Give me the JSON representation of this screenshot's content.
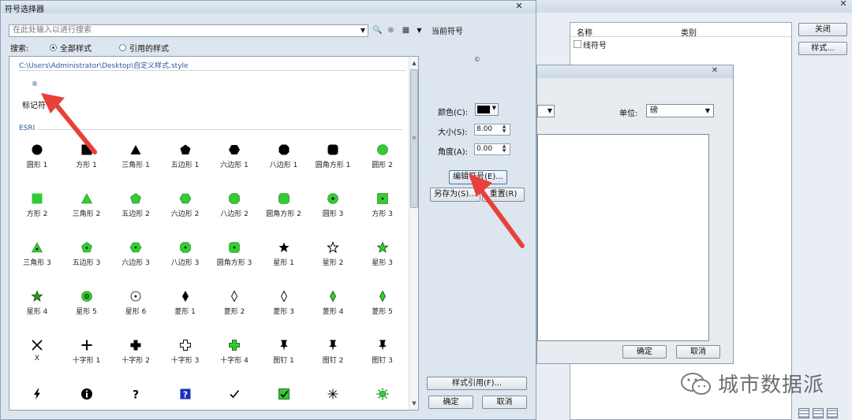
{
  "background_window": {
    "list_headers": [
      "名称",
      "类别"
    ],
    "list_items": [
      "线符号"
    ],
    "close_label": "关闭",
    "styles_label": "样式..."
  },
  "middle_dialog": {
    "unit_label": "单位:",
    "unit_value": "磅",
    "ok_label": "确定",
    "cancel_label": "取消"
  },
  "main_dialog": {
    "title": "符号选择器",
    "search_placeholder": "在此处输入以进行搜索",
    "scope_label": "搜索:",
    "radio_all": "全部样式",
    "radio_referenced": "引用的样式",
    "style_path": "C:\\Users\\Administrator\\Desktop\\自定义样式.style",
    "custom_symbol_label": "标记符",
    "custom_symbol_glyph": "®",
    "esri_group_label": "ESRI",
    "symbols": [
      {
        "label": "圆形 1",
        "icon": "circle-black"
      },
      {
        "label": "方形 1",
        "icon": "square-black"
      },
      {
        "label": "三角形 1",
        "icon": "triangle-black"
      },
      {
        "label": "五边形 1",
        "icon": "pentagon-black"
      },
      {
        "label": "六边形 1",
        "icon": "hexagon-black"
      },
      {
        "label": "八边形 1",
        "icon": "octagon-black"
      },
      {
        "label": "圆角方形 1",
        "icon": "rounded-square-black"
      },
      {
        "label": "圆形 2",
        "icon": "circle-green"
      },
      {
        "label": "方形 2",
        "icon": "square-green"
      },
      {
        "label": "三角形 2",
        "icon": "triangle-green"
      },
      {
        "label": "五边形 2",
        "icon": "pentagon-green"
      },
      {
        "label": "六边形 2",
        "icon": "hexagon-green"
      },
      {
        "label": "八边形 2",
        "icon": "octagon-green"
      },
      {
        "label": "圆角方形 2",
        "icon": "rounded-square-green"
      },
      {
        "label": "圆形 3",
        "icon": "circle-green-dot"
      },
      {
        "label": "方形 3",
        "icon": "square-green-dot"
      },
      {
        "label": "三角形 3",
        "icon": "triangle-green-dot"
      },
      {
        "label": "五边形 3",
        "icon": "pentagon-green-dot"
      },
      {
        "label": "六边形 3",
        "icon": "hexagon-green-dot"
      },
      {
        "label": "八边形 3",
        "icon": "octagon-green-dot"
      },
      {
        "label": "圆角方形 3",
        "icon": "rounded-square-green-dot"
      },
      {
        "label": "星形 1",
        "icon": "star-black"
      },
      {
        "label": "星形 2",
        "icon": "star-outline"
      },
      {
        "label": "星形 3",
        "icon": "star-green"
      },
      {
        "label": "星形 4",
        "icon": "star-green-dark"
      },
      {
        "label": "星形 5",
        "icon": "circle-green-ring"
      },
      {
        "label": "星形 6",
        "icon": "circle-outline-dot"
      },
      {
        "label": "菱形 1",
        "icon": "diamond-black"
      },
      {
        "label": "菱形 2",
        "icon": "diamond-outline"
      },
      {
        "label": "菱形 3",
        "icon": "diamond-outline-2"
      },
      {
        "label": "菱形 4",
        "icon": "diamond-green"
      },
      {
        "label": "菱形 5",
        "icon": "diamond-green-2"
      },
      {
        "label": "X",
        "icon": "x-mark"
      },
      {
        "label": "十字形 1",
        "icon": "cross-thin"
      },
      {
        "label": "十字形 2",
        "icon": "cross-bold"
      },
      {
        "label": "十字形 3",
        "icon": "cross-outline"
      },
      {
        "label": "十字形 4",
        "icon": "cross-green"
      },
      {
        "label": "图钉 1",
        "icon": "pin-1"
      },
      {
        "label": "图钉 2",
        "icon": "pin-2"
      },
      {
        "label": "图钉 3",
        "icon": "pin-3"
      },
      {
        "label": "",
        "icon": "lightning"
      },
      {
        "label": "",
        "icon": "info-circle"
      },
      {
        "label": "",
        "icon": "question-mark"
      },
      {
        "label": "",
        "icon": "question-box"
      },
      {
        "label": "",
        "icon": "check-mark"
      },
      {
        "label": "",
        "icon": "check-box-green"
      },
      {
        "label": "",
        "icon": "asterisk"
      },
      {
        "label": "",
        "icon": "sun-green"
      }
    ]
  },
  "current_symbol": {
    "title": "当前符号",
    "preview_glyph": "©",
    "color_label": "颜色(C):",
    "color_value": "#000000",
    "size_label": "大小(S):",
    "size_value": "8.00",
    "angle_label": "角度(A):",
    "angle_value": "0.00",
    "edit_label": "编辑符号(E)...",
    "saveas_label": "另存为(S)...",
    "reset_label": "重置(R)",
    "style_ref_label": "样式引用(F)...",
    "ok_label": "确定",
    "cancel_label": "取消"
  },
  "watermark": {
    "text": "城市数据派"
  },
  "colors": {
    "accent_blue": "#2d5aa0",
    "symbol_green": "#33cc33",
    "arrow_red": "#e8403a"
  }
}
